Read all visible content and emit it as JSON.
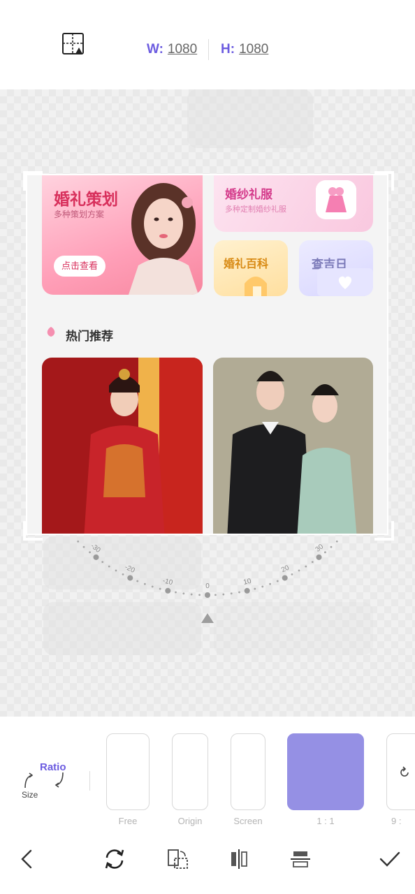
{
  "header": {
    "width_label": "W:",
    "width_value": "1080",
    "height_label": "H:",
    "height_value": "1080"
  },
  "crop_content": {
    "plan_title": "婚礼策划",
    "plan_subtitle": "多种策划方案",
    "plan_button": "点击查看",
    "dress_title": "婚纱礼服",
    "dress_subtitle": "多种定制婚纱礼服",
    "wiki_title": "婚礼百科",
    "date_title": "查吉日",
    "hot_title": "热门推荐"
  },
  "dial": {
    "ticks": [
      "-30",
      "-20",
      "-10",
      "0",
      "10",
      "20",
      "30"
    ]
  },
  "bottom": {
    "ratio_label": "Ratio",
    "size_label": "Size",
    "options": [
      "Free",
      "Origin",
      "Screen",
      "1 : 1",
      "9 :"
    ],
    "selected": "1 : 1"
  },
  "colors": {
    "accent": "#6c5ce0",
    "selected_ratio": "#9590e4"
  }
}
